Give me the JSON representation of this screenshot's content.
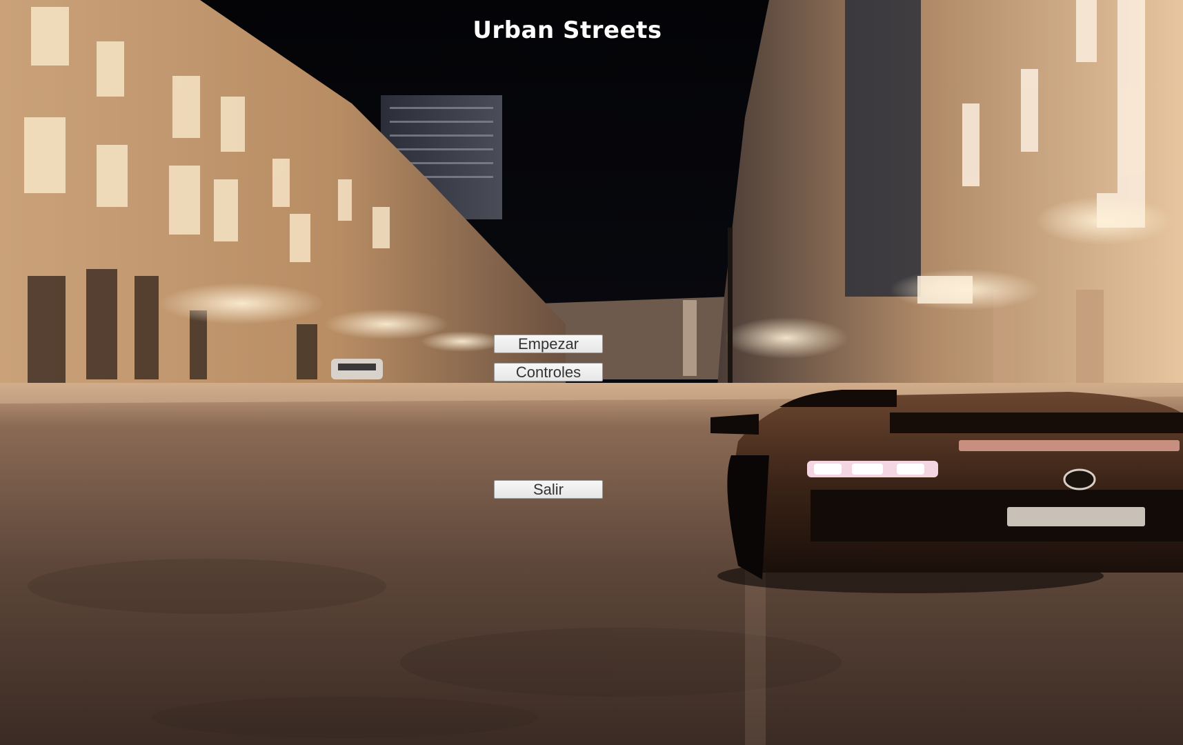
{
  "game": {
    "title": "Urban Streets"
  },
  "menu": {
    "start_label": "Empezar",
    "controls_label": "Controles",
    "exit_label": "Salir"
  },
  "colors": {
    "sky": "#07080c",
    "building_light": "#e9c9a0",
    "road": "#5a4436",
    "car_body": "#3a2316",
    "button_bg": "#efefef",
    "button_text": "#333333",
    "title_text": "#ffffff"
  }
}
